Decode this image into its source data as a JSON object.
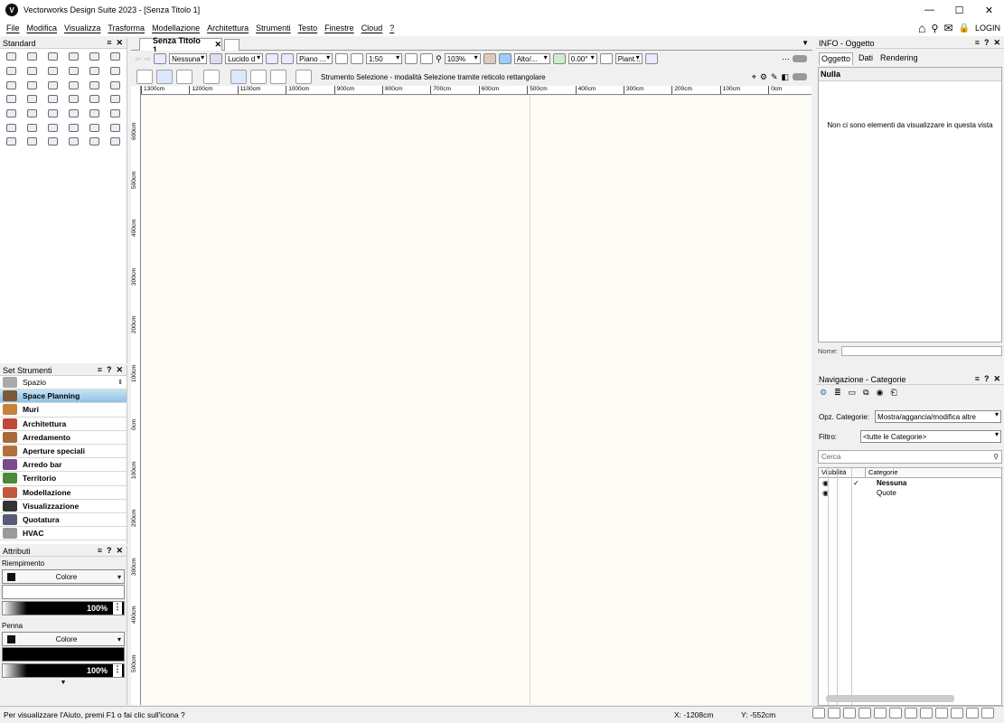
{
  "titlebar": {
    "app_icon": "V",
    "title": "Vectorworks Design Suite 2023 - [Senza Titolo 1]",
    "minimize": "—",
    "maximize": "☐",
    "close": "✕"
  },
  "menubar": {
    "items": [
      "File",
      "Modifica",
      "Visualizza",
      "Trasforma",
      "Modellazione",
      "Architettura",
      "Strumenti",
      "Testo",
      "Finestre",
      "Cloud",
      "?"
    ],
    "login": "LOGIN"
  },
  "standard_panel": {
    "title": "Standard"
  },
  "set_strumenti": {
    "title": "Set Strumenti",
    "spazio": "Spazio",
    "items": [
      {
        "label": "Space Planning",
        "color": "#7a5a3a"
      },
      {
        "label": "Muri",
        "color": "#c8823a"
      },
      {
        "label": "Architettura",
        "color": "#c04a3a"
      },
      {
        "label": "Arredamento",
        "color": "#a86a3a"
      },
      {
        "label": "Aperture speciali",
        "color": "#b07040"
      },
      {
        "label": "Arredo bar",
        "color": "#7a4a8a"
      },
      {
        "label": "Territorio",
        "color": "#4a8a3a"
      },
      {
        "label": "Modellazione",
        "color": "#c05a3a"
      },
      {
        "label": "Visualizzazione",
        "color": "#333333"
      },
      {
        "label": "Quotatura",
        "color": "#5a5a7a"
      },
      {
        "label": "HVAC",
        "color": "#9a9a9a"
      }
    ]
  },
  "attributi": {
    "title": "Attributi",
    "riempimento": "Riempimento",
    "fill_type": "Colore",
    "fill_opacity": "100%",
    "penna": "Penna",
    "pen_type": "Colore",
    "pen_opacity": "100%"
  },
  "document": {
    "tab_label": "Senza Titolo 1"
  },
  "toolbar1": {
    "class": "Nessuna",
    "layer": "Lucido d",
    "plane": "Piano ...",
    "scale": "1:50",
    "zoom": "103%",
    "view": "Alto/...",
    "angle": "0.00°",
    "render": "Piant..."
  },
  "toolbar2": {
    "mode_text": "Strumento Selezione - modalità Selezione tramite reticolo rettangolare"
  },
  "ruler": {
    "h_labels": [
      "1300cm",
      "1200cm",
      "1100cm",
      "1000cm",
      "900cm",
      "800cm",
      "700cm",
      "600cm",
      "500cm",
      "400cm",
      "300cm",
      "200cm",
      "100cm",
      "0cm"
    ],
    "v_labels": [
      "600cm",
      "500cm",
      "400cm",
      "300cm",
      "200cm",
      "100cm",
      "0cm",
      "100cm",
      "200cm",
      "300cm",
      "400cm",
      "500cm"
    ]
  },
  "info_panel": {
    "title": "INFO - Oggetto",
    "tabs": [
      "Oggetto",
      "Dati",
      "Rendering"
    ],
    "selection": "Nulla",
    "empty_message": "Non ci sono elementi da visualizzare in questa vista",
    "nome_label": "Nome:"
  },
  "nav_panel": {
    "title": "Navigazione - Categorie",
    "opz_label": "Opz. Categorie:",
    "opz_value": "Mostra/aggancia/modifica altre",
    "filtro_label": "Filtro:",
    "filtro_value": "<tutte le Categorie>",
    "search_placeholder": "Cerca",
    "col_visibility": "Visibilità",
    "col_categories": "Categorie",
    "rows": [
      {
        "name": "Nessuna",
        "active": "✓",
        "bold": true
      },
      {
        "name": "Quote",
        "active": "",
        "bold": false
      }
    ]
  },
  "status": {
    "hint": "Per visualizzare l'Aiuto, premi F1 o fai clic sull'icona ?",
    "x": "X:  -1208cm",
    "y": "Y:   -552cm"
  }
}
